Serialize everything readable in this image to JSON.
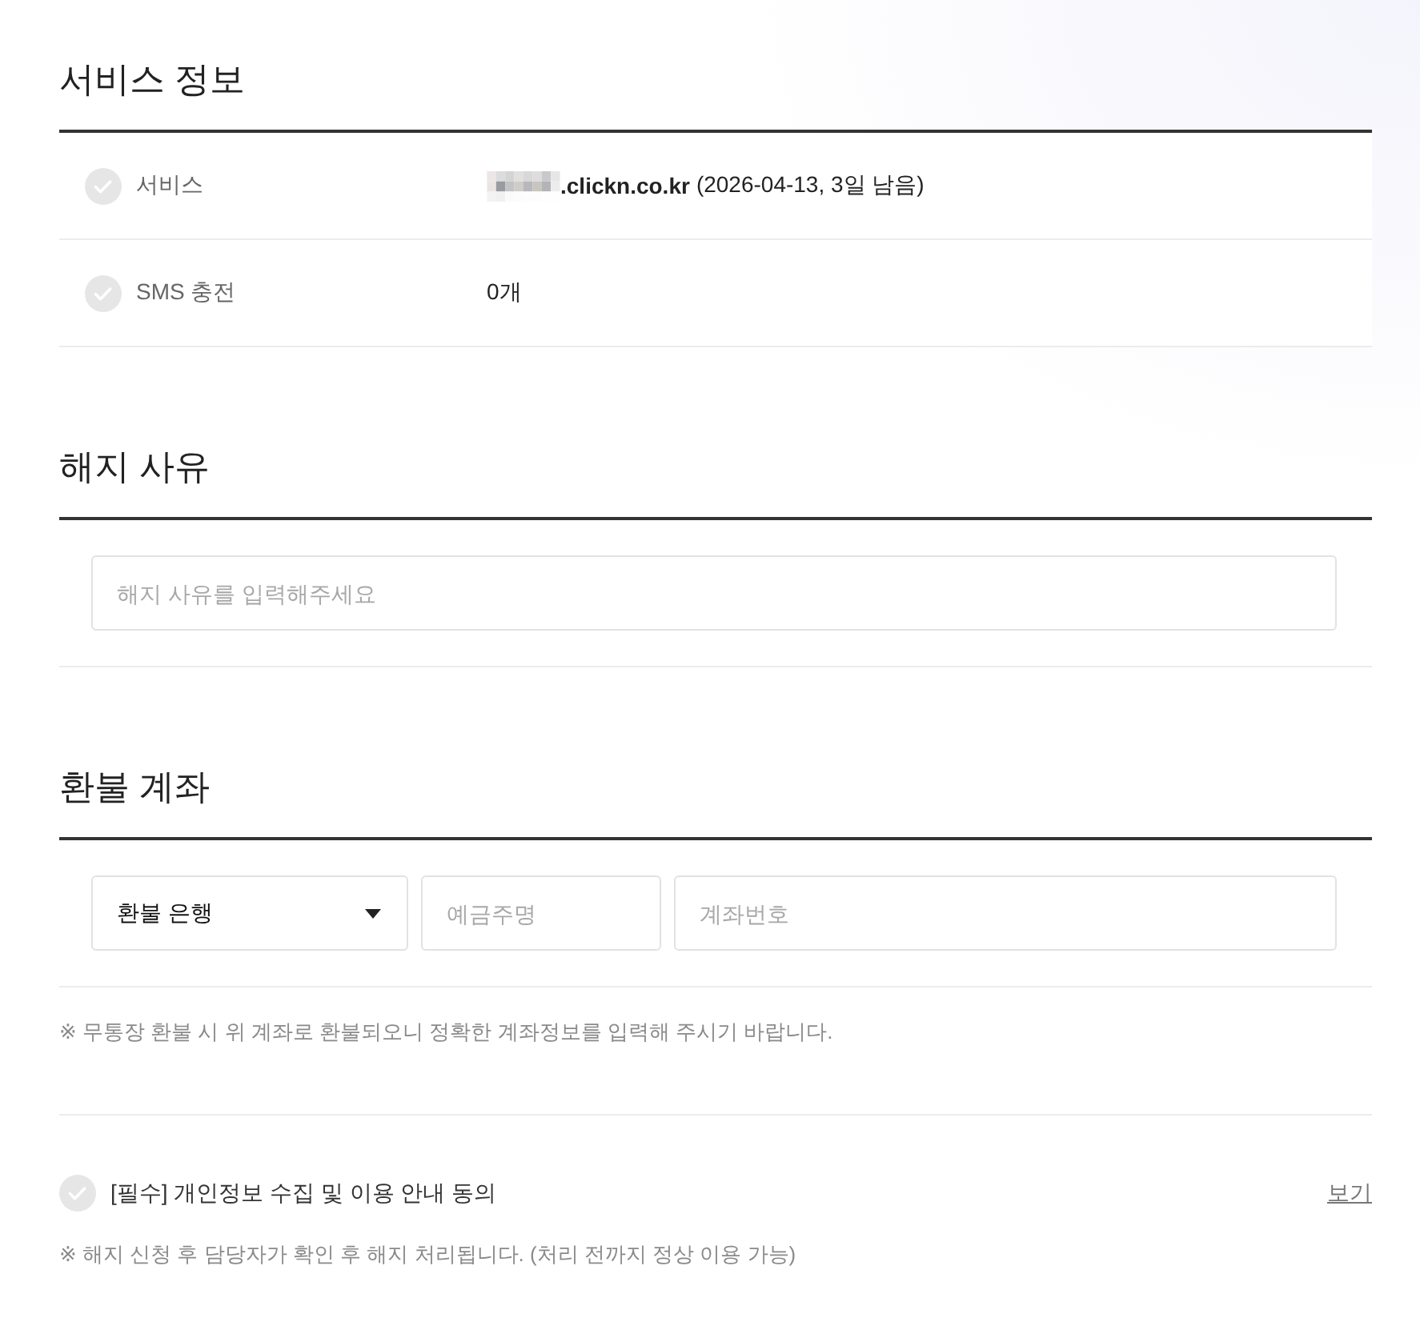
{
  "service_info": {
    "title": "서비스 정보",
    "rows": [
      {
        "kind": "service",
        "label": "서비스",
        "domain": ".clickn.co.kr",
        "detail": "(2026-04-13, 3일 남음)"
      },
      {
        "kind": "plain",
        "label": "SMS 충전",
        "value": "0개"
      }
    ]
  },
  "cancel_reason": {
    "title": "해지 사유",
    "field": {
      "placeholder": "해지 사유를 입력해주세요"
    }
  },
  "refund_account": {
    "title": "환불 계좌",
    "bank_select": {
      "value": "환불 은행"
    },
    "holder_field": {
      "placeholder": "예금주명"
    },
    "account_field": {
      "placeholder": "계좌번호"
    },
    "note": "※ 무통장 환불 시 위 계좌로 환불되오니 정확한 계좌정보를 입력해 주시기 바랍니다."
  },
  "agreement": {
    "checked": false,
    "label": "[필수] 개인정보 수집 및 이용 안내 동의",
    "link": "보기"
  },
  "footer_note": "※ 해지 신청 후 담당자가 확인 후 해지 처리됩니다. (처리 전까지 정상 이용 가능)"
}
